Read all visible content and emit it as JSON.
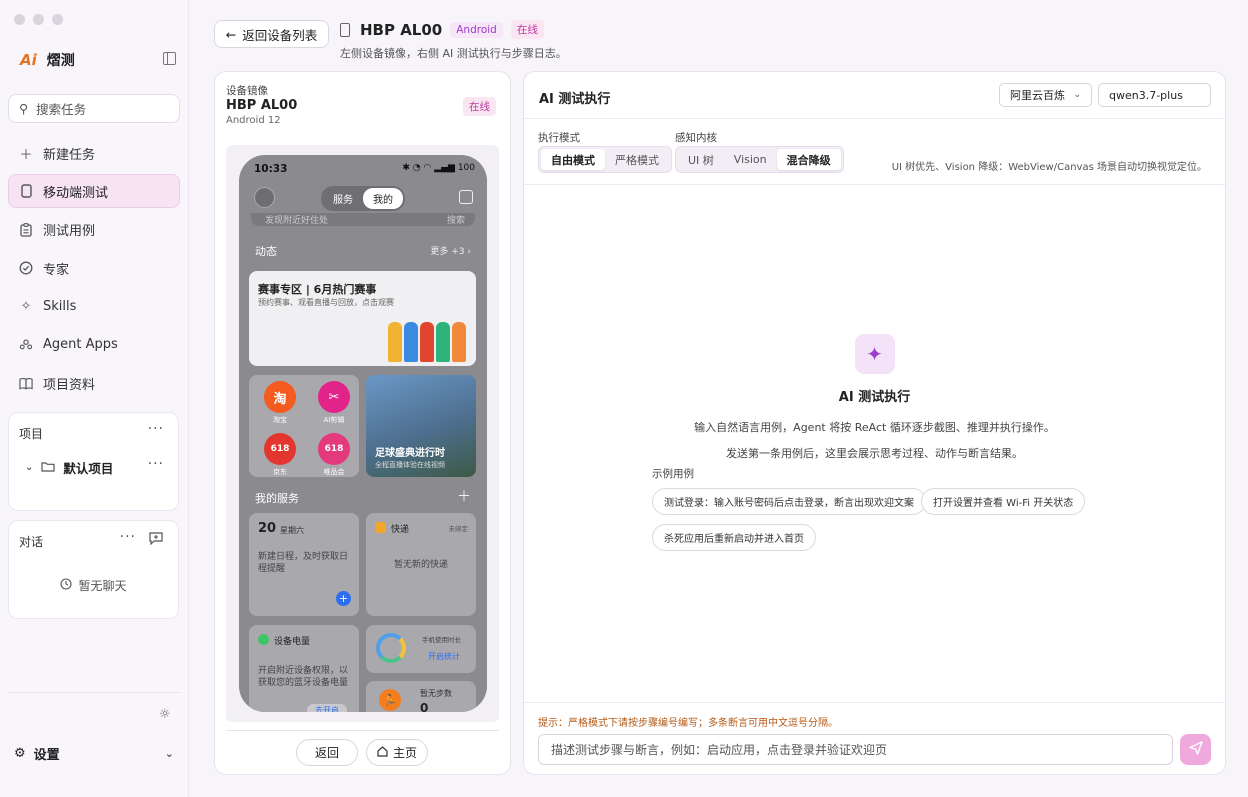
{
  "app": {
    "name": "熠测",
    "logo": "Ai"
  },
  "sidebar": {
    "search_placeholder": "搜索任务",
    "items": [
      {
        "label": "新建任务",
        "icon": "plus-icon"
      },
      {
        "label": "移动端测试",
        "icon": "phone-icon",
        "active": true
      },
      {
        "label": "测试用例",
        "icon": "clipboard-icon"
      },
      {
        "label": "专家",
        "icon": "check-circle-icon"
      },
      {
        "label": "Skills",
        "icon": "sparkle-icon"
      },
      {
        "label": "Agent Apps",
        "icon": "people-icon"
      },
      {
        "label": "项目资料",
        "icon": "book-icon"
      }
    ],
    "projects": {
      "title": "项目",
      "default_project": "默认项目"
    },
    "chats": {
      "title": "对话",
      "empty": "暂无聊天"
    },
    "settings": "设置"
  },
  "header": {
    "back_label": "返回设备列表",
    "device_name": "HBP AL00",
    "platform_badge": "Android",
    "status_badge": "在线",
    "subtitle": "左侧设备镜像，右侧 AI 测试执行与步骤日志。"
  },
  "device_panel": {
    "label": "设备镜像",
    "name": "HBP AL00",
    "os": "Android 12",
    "status": "在线",
    "back_button": "返回",
    "home_button": "主页",
    "screen": {
      "time": "10:33",
      "status_icons": "✱ ◔ ◠ ▂▄▆ 100",
      "tab_service": "服务",
      "tab_mine": "我的",
      "search_hint": "发现附近好住处",
      "search_btn": "搜索",
      "section_dynamic": "动态",
      "more": "更多 +3 ›",
      "banner_title": "赛事专区 | 6月热门赛事",
      "banner_sub": "预约赛事、观看直播与回放，点击观赛",
      "apps": [
        {
          "label": "淘宝",
          "glyph": "淘",
          "color": "#f55a1e"
        },
        {
          "label": "AI剪辑",
          "glyph": "✂",
          "color": "#e2248a"
        },
        {
          "label": "京东",
          "glyph": "618",
          "color": "#e3362f"
        },
        {
          "label": "唯品会",
          "glyph": "618",
          "color": "#e4397d"
        }
      ],
      "promo_title": "足球盛典进行时",
      "promo_sub": "全程直播体验在线视频",
      "my_services": "我的服务",
      "date_num": "20",
      "weekday": "星期六",
      "schedule_text": "新建日程，及时获取日程提醒",
      "express_title": "快递",
      "express_status": "未绑定",
      "express_empty": "暂无新的快递",
      "battery_title": "设备电量",
      "battery_text": "以获取您的蓝牙设备电量",
      "battery_text_full": "开启附近设备权限，以获取您的蓝牙设备电量",
      "battery_btn": "去开启",
      "usage_title": "手机使用时长",
      "usage_btn": "开启统计",
      "steps_title": "暂无步数",
      "steps_value": "0"
    }
  },
  "ai_panel": {
    "title": "AI 测试执行",
    "provider": "阿里云百炼",
    "model": "qwen3.7-plus",
    "exec_mode_label": "执行模式",
    "exec_modes": [
      "自由模式",
      "严格模式"
    ],
    "perception_label": "感知内核",
    "perception_modes": [
      "UI 树",
      "Vision",
      "混合降级"
    ],
    "perception_hint": "UI 树优先、Vision 降级：WebView/Canvas 场景自动切换视觉定位。",
    "empty_title": "AI 测试执行",
    "empty_desc_1": "输入自然语言用例，Agent 将按 ReAct 循环逐步截图、推理并执行操作。",
    "empty_desc_2": "发送第一条用例后，这里会展示思考过程、动作与断言结果。",
    "examples_label": "示例用例",
    "examples": [
      "测试登录：输入账号密码后点击登录，断言出现欢迎文案",
      "打开设置并查看 Wi-Fi 开关状态",
      "杀死应用后重新启动并进入首页"
    ],
    "tip": "提示：严格模式下请按步骤编号编写；多条断言可用中文逗号分隔。",
    "input_placeholder": "描述测试步骤与断言，例如：启动应用，点击登录并验证欢迎页"
  },
  "colors": {
    "accent": "#9b3ec8",
    "active_bg": "#f7e4f3",
    "send": "#f0a9dd",
    "tip": "#b35a18"
  }
}
